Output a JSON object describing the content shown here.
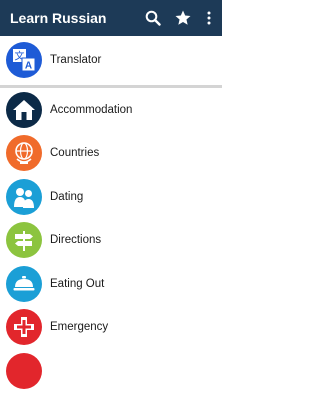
{
  "appbar": {
    "title": "Learn Russian",
    "bg": "#1d3a57",
    "actions": [
      "search-icon",
      "star-icon",
      "more-vert-icon"
    ]
  },
  "translator": {
    "label": "Translator",
    "icon": "translate-icon",
    "color": "#1e5bd6"
  },
  "categories": [
    {
      "label": "Accommodation",
      "icon": "house-icon",
      "color": "#0c2a47"
    },
    {
      "label": "Countries",
      "icon": "globe-icon",
      "color": "#f06b2b"
    },
    {
      "label": "Dating",
      "icon": "couple-icon",
      "color": "#1b9fd6"
    },
    {
      "label": "Directions",
      "icon": "signpost-icon",
      "color": "#8cc43f"
    },
    {
      "label": "Eating Out",
      "icon": "dish-icon",
      "color": "#1b9fd6"
    },
    {
      "label": "Emergency",
      "icon": "first-aid-icon",
      "color": "#e2262c"
    }
  ]
}
